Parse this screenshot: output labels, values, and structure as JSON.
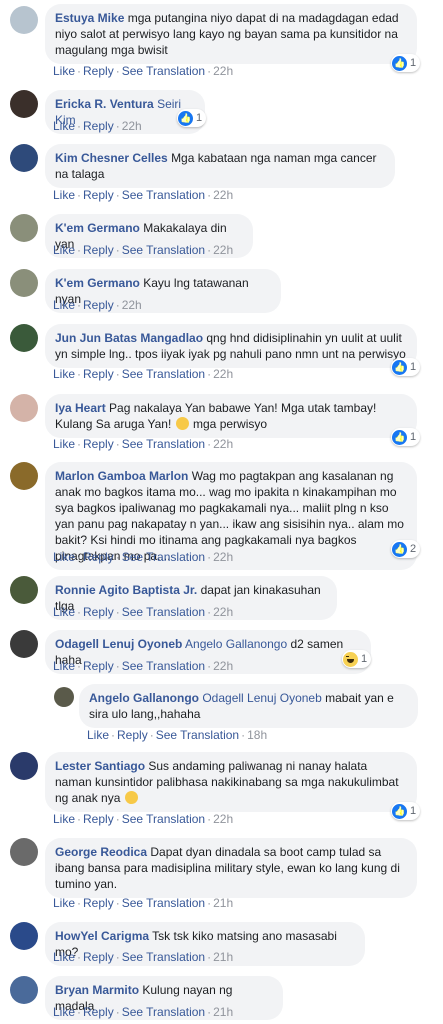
{
  "actions": {
    "like": "Like",
    "reply": "Reply",
    "see_translation": "See Translation"
  },
  "comments": [
    {
      "author": "Estuya Mike",
      "text": "mga putangina niyo dapat di na madagdagan edad niyo salot at perwisyo lang kayo ng bayan sama pa kunsitidor na magulang mga bwisit",
      "time": "22h",
      "reaction_count": "1"
    },
    {
      "author": "Ericka R. Ventura",
      "tag": "Seiri Kim",
      "text": "",
      "time": "22h",
      "reaction_count": "1"
    },
    {
      "author": "Kim Chesner Celles",
      "text": "Mga kabataan nga naman mga cancer na talaga",
      "time": "22h"
    },
    {
      "author": "K'em Germano",
      "text": "Makakalaya din yan",
      "time": "22h"
    },
    {
      "author": "K'em Germano",
      "text": "Kayu lng tatawanan nyan",
      "time": "22h"
    },
    {
      "author": "Jun Jun Batas Mangadlao",
      "text": "qng hnd didisiplinahin yn uulit at uulit yn simple lng.. tpos iiyak iyak pg nahuli pano nmn unt na perwisyo",
      "time": "22h",
      "reaction_count": "1"
    },
    {
      "author": "Iya Heart",
      "text": "Pag nakalaya Yan babawe Yan! Mga utak tambay! Kulang Sa aruga Yan!",
      "text_after_emoji": "mga perwisyo",
      "time": "22h",
      "reaction_count": "1"
    },
    {
      "author": "Marlon Gamboa Marlon",
      "text": "Wag mo pagtakpan ang kasalanan ng anak mo bagkos itama mo... wag mo ipakita n kinakampihan mo sya bagkos ipaliwanag mo pagkakamali nya... maliit plng n kso yan panu pag nakapatay n yan... ikaw ang sisisihin nya.. alam mo bakit? Ksi hindi mo itinama ang pagkakamali nya bagkos pinagtakpan mo pa....",
      "time": "22h",
      "reaction_count": "2"
    },
    {
      "author": "Ronnie Agito Baptista Jr.",
      "text": "dapat jan kinakasuhan tlga",
      "time": "22h"
    },
    {
      "author": "Odagell Lenuj Oyoneb",
      "tag": "Angelo Gallanongo",
      "text": "d2 samen haha",
      "time": "22h",
      "reaction_count": "1"
    },
    {
      "author": "Angelo Gallanongo",
      "tag": "Odagell Lenuj Oyoneb",
      "text": "mabait yan e sira ulo lang,,hahaha",
      "time": "18h"
    },
    {
      "author": "Lester Santiago",
      "text": "Sus andaming paliwanag ni nanay halata naman kunsintidor palibhasa nakikinabang sa mga nakukulimbat ng anak nya",
      "time": "22h",
      "reaction_count": "1"
    },
    {
      "author": "George Reodica",
      "text": "Dapat dyan dinadala sa boot camp tulad sa ibang bansa para madisiplina military style, ewan ko lang kung di tumino yan.",
      "time": "21h"
    },
    {
      "author": "HowYel Carigma",
      "text": "Tsk tsk kiko matsing ano masasabi mo?",
      "time": "21h"
    },
    {
      "author": "Bryan Marmito",
      "text": "Kulung nayan ng madala",
      "time": "21h"
    }
  ]
}
